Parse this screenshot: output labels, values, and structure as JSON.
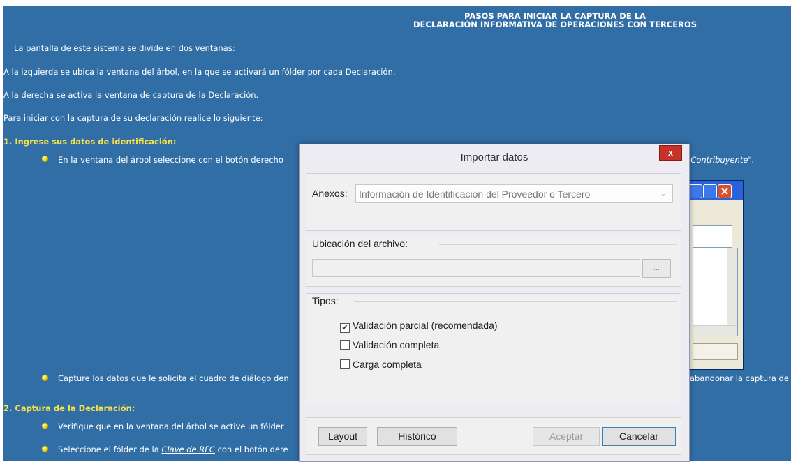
{
  "background": {
    "title_line1": "PASOS PARA INICIAR LA CAPTURA DE LA",
    "title_line2": "DECLARACIÓN INFORMATIVA DE OPERACIONES CON TERCEROS",
    "intro": "La pantalla de este sistema se divide en dos ventanas:",
    "left_window": "A la izquierda se ubica la ventana del árbol, en la que se activará un fólder por cada Declaración.",
    "right_window": "A la derecha se activa la ventana de captura de la Declaración.",
    "start": "Para iniciar con la captura de su declaración realice lo siguiente:",
    "section1_header": "1. Ingrese sus datos de identificación:",
    "bullet1": "En la ventana del árbol seleccione con el botón derecho",
    "bullet1_tail": "\"Contribuyente\".",
    "bullet2": "Capture los datos que le solicita el cuadro de diálogo den",
    "bullet2_tail": "abandonar la captura de",
    "section2_header": "2. Captura de la Declaración:",
    "bullet3": "Verifique que en la ventana del árbol se active un fólder",
    "bullet4_pre": "Seleccione el fólder de la ",
    "bullet4_em": "Clave de RFC",
    "bullet4_post": " con el botón dere"
  },
  "colors": {
    "background": "#326ea6",
    "section_header": "#f6e04a",
    "dialog_close": "#c4322a"
  },
  "dialog": {
    "title": "Importar datos",
    "close_icon": "close-icon",
    "anexos_label": "Anexos:",
    "anexos_value": "Información de Identificación del Proveedor o Tercero",
    "ubicacion_label": "Ubicación del archivo:",
    "file_path_value": "",
    "browse_label": "...",
    "tipos_label": "Tipos:",
    "options": [
      {
        "label": "Validación parcial (recomendada)",
        "checked": true
      },
      {
        "label": "Validación completa",
        "checked": false
      },
      {
        "label": "Carga completa",
        "checked": false
      }
    ],
    "buttons": {
      "layout": "Layout",
      "historico": "Histórico",
      "aceptar": "Aceptar",
      "cancelar": "Cancelar"
    }
  }
}
